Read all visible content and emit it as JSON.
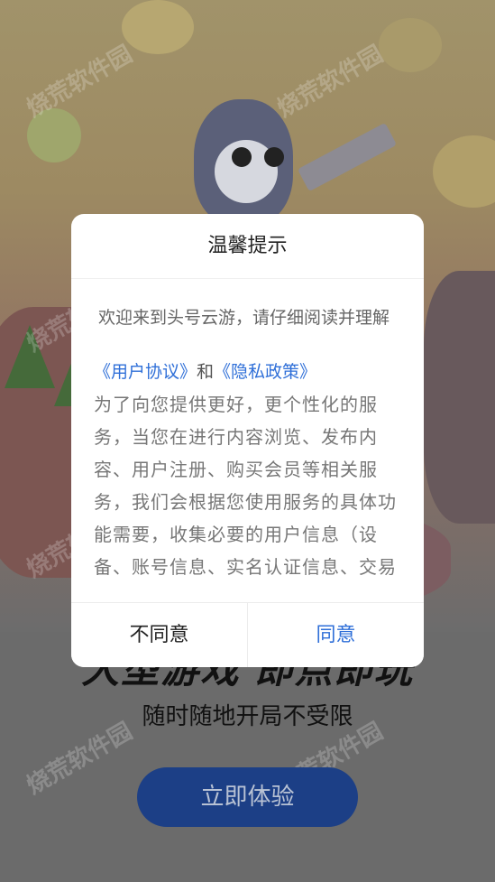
{
  "background": {
    "headline": "大型游戏 即点即玩",
    "subline": "随时随地开局不受限",
    "cta_label": "立即体验",
    "watermark": "烧荒软件园"
  },
  "dialog": {
    "title": "温馨提示",
    "intro": "欢迎来到头号云游，请仔细阅读并理解",
    "user_agreement": "《用户协议》",
    "and": "和",
    "privacy_policy": "《隐私政策》",
    "body": "为了向您提供更好，更个性化的服务，当您在进行内容浏览、发布内容、用户注册、购买会员等相关服务，我们会根据您使用服务的具体功能需要，收集必要的用户信息（设备、账号信息、实名认证信息、交易",
    "decline_label": "不同意",
    "accept_label": "同意"
  },
  "colors": {
    "accent": "#2f6fd8",
    "cta_bg": "#1c3f86"
  }
}
